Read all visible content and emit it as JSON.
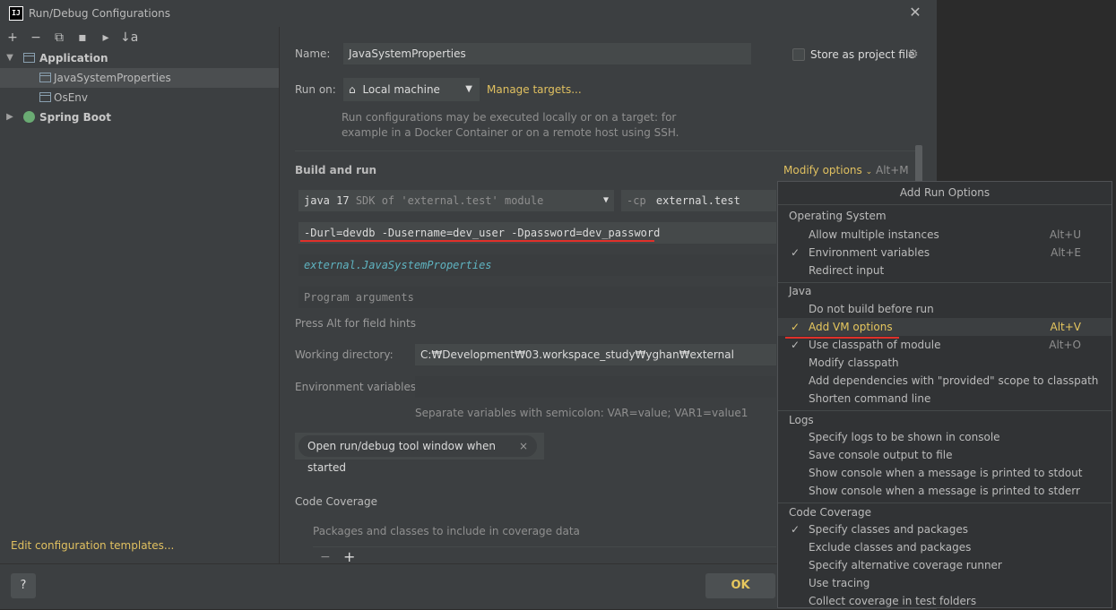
{
  "window": {
    "title": "Run/Debug Configurations",
    "app_icon": "IJ"
  },
  "toolbar": {
    "add": "+",
    "remove": "−",
    "copy": "⧉",
    "save": "▪",
    "folder": "▸",
    "sort": "↓a"
  },
  "tree": {
    "application": "Application",
    "items": [
      "JavaSystemProperties",
      "OsEnv"
    ],
    "spring_boot": "Spring Boot"
  },
  "edit_templates": "Edit configuration templates...",
  "form": {
    "name_label": "Name:",
    "name_value": "JavaSystemProperties",
    "store_label": "Store as project file",
    "run_on_label": "Run on:",
    "run_on_value": "Local machine",
    "manage_targets": "Manage targets...",
    "run_hint_1": "Run configurations may be executed locally or on a target: for",
    "run_hint_2": "example in a Docker Container or on a remote host using SSH.",
    "build_and_run": "Build and run",
    "modify_options": "Modify options",
    "modify_shortcut": "Alt+M",
    "jdk_version": "java 17",
    "jdk_detail": "SDK of 'external.test' module",
    "cp_flag": "-cp",
    "cp_value": "external.test",
    "vm_options": "-Durl=devdb -Dusername=dev_user -Dpassword=dev_password",
    "main_class": "external.JavaSystemProperties",
    "program_args_placeholder": "Program arguments",
    "alt_hint": "Press Alt for field hints",
    "working_dir_label": "Working directory:",
    "working_dir_value": "C:₩Development₩03.workspace_study₩yghan₩external",
    "env_vars_label": "Environment variables:",
    "env_hint": "Separate variables with semicolon: VAR=value; VAR1=value1",
    "chip": "Open run/debug tool window when started",
    "chip_close": "×",
    "code_coverage": "Code Coverage",
    "coverage_hint": "Packages and classes to include in coverage data",
    "cov_minus": "−",
    "cov_plus": "+"
  },
  "bottom": {
    "help": "?",
    "ok": "OK"
  },
  "popup": {
    "title": "Add Run Options",
    "groups": {
      "os": "Operating System",
      "java": "Java",
      "logs": "Logs",
      "coverage": "Code Coverage"
    },
    "items": [
      {
        "label": "Allow multiple instances",
        "shortcut": "Alt+U",
        "checked": ""
      },
      {
        "label": "Environment variables",
        "shortcut": "Alt+E",
        "checked": "✓"
      },
      {
        "label": "Redirect input",
        "shortcut": "",
        "checked": ""
      },
      {
        "label": "Do not build before run",
        "shortcut": "",
        "checked": ""
      },
      {
        "label": "Add VM options",
        "shortcut": "Alt+V",
        "checked": "✓"
      },
      {
        "label": "Use classpath of module",
        "shortcut": "Alt+O",
        "checked": "✓"
      },
      {
        "label": "Modify classpath",
        "shortcut": "",
        "checked": ""
      },
      {
        "label": "Add dependencies with \"provided\" scope to classpath",
        "shortcut": "",
        "checked": ""
      },
      {
        "label": "Shorten command line",
        "shortcut": "",
        "checked": ""
      },
      {
        "label": "Specify logs to be shown in console",
        "shortcut": "",
        "checked": ""
      },
      {
        "label": "Save console output to file",
        "shortcut": "",
        "checked": ""
      },
      {
        "label": "Show console when a message is printed to stdout",
        "shortcut": "",
        "checked": ""
      },
      {
        "label": "Show console when a message is printed to stderr",
        "shortcut": "",
        "checked": ""
      },
      {
        "label": "Specify classes and packages",
        "shortcut": "",
        "checked": "✓"
      },
      {
        "label": "Exclude classes and packages",
        "shortcut": "",
        "checked": ""
      },
      {
        "label": "Specify alternative coverage runner",
        "shortcut": "",
        "checked": ""
      },
      {
        "label": "Use tracing",
        "shortcut": "",
        "checked": ""
      },
      {
        "label": "Collect coverage in test folders",
        "shortcut": "",
        "checked": ""
      }
    ]
  },
  "colors": {
    "accent": "#e0c060",
    "underline": "#e0302a",
    "main_class": "#5fb3c0"
  }
}
